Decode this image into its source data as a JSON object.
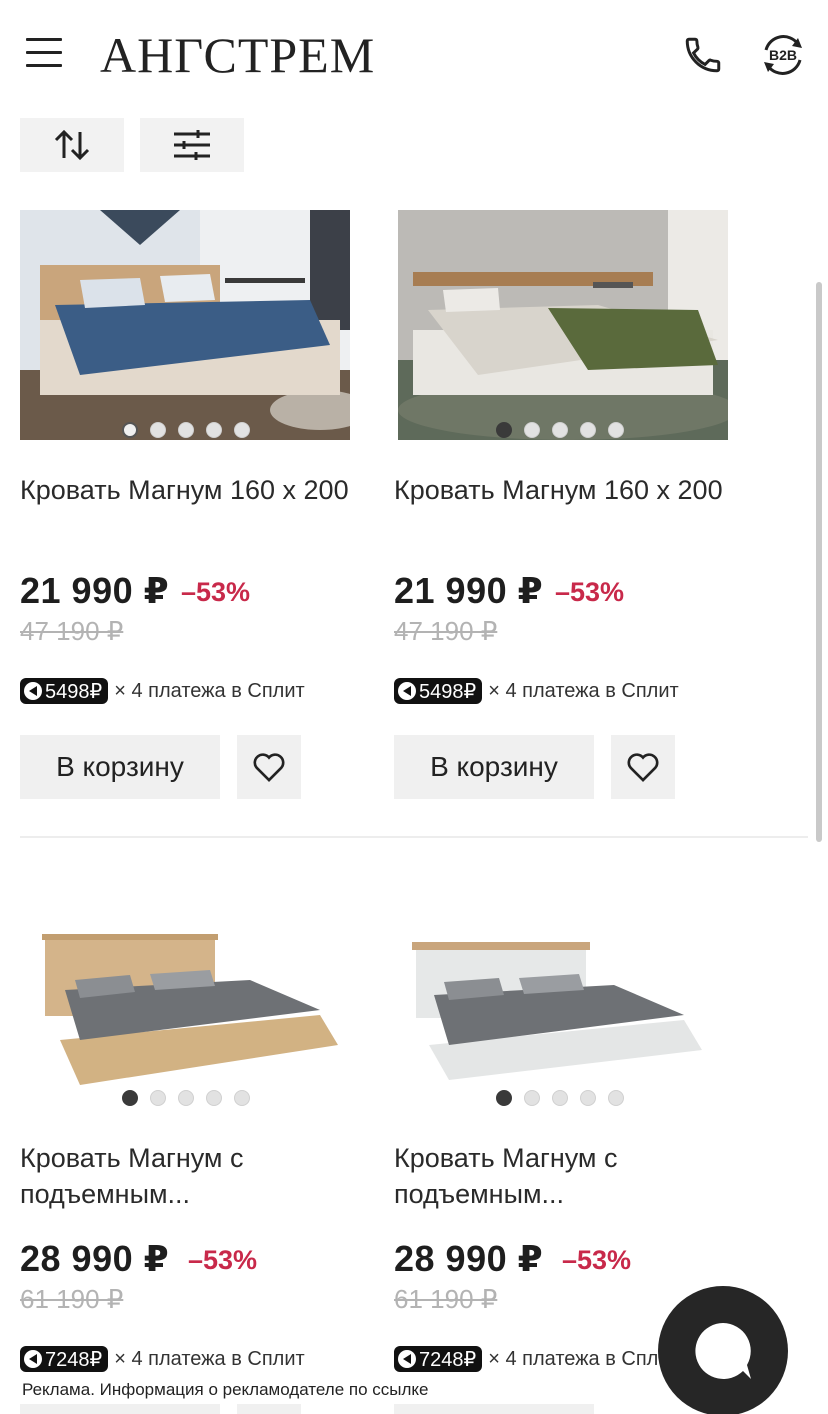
{
  "header": {
    "logo": "АНГСТРЕМ",
    "menu_icon": "hamburger-menu-icon",
    "phone_icon": "phone-icon",
    "b2b_label": "B2B"
  },
  "toolbar": {
    "sort_icon": "sort-arrows-icon",
    "filter_icon": "filter-sliders-icon"
  },
  "products": [
    {
      "title": "Кровать Магнум 160 х 200",
      "price": "21 990 ₽",
      "discount": "–53%",
      "old_price": "47 190 ₽",
      "split_amount": "5498₽",
      "split_text": "× 4 платежа в Сплит",
      "cart_label": "В корзину",
      "image_icon": "bed-photo-blue-bedding"
    },
    {
      "title": "Кровать Магнум 160 х 200",
      "price": "21 990 ₽",
      "discount": "–53%",
      "old_price": "47 190 ₽",
      "split_amount": "5498₽",
      "split_text": "× 4 платежа в Сплит",
      "cart_label": "В корзину",
      "image_icon": "bed-photo-green-bedding"
    },
    {
      "title": "Кровать Магнум с подъемным...",
      "price": "28 990 ₽",
      "discount": "–53%",
      "old_price": "61 190 ₽",
      "split_amount": "7248₽",
      "split_text": "× 4 платежа в Сплит",
      "image_icon": "bed-photo-oak"
    },
    {
      "title": "Кровать Магнум с подъемным...",
      "price": "28 990 ₽",
      "discount": "–53%",
      "old_price": "61 190 ₽",
      "split_amount": "7248₽",
      "split_text": "× 4 платежа в Спл",
      "image_icon": "bed-photo-white"
    }
  ],
  "chat": {
    "icon": "chat-bubble-icon"
  },
  "ad_note": "Реклама. Информация о рекламодателе по ссылке",
  "colors": {
    "discount": "#c8294a",
    "badge": "#111111",
    "button_bg": "#f0f0f0"
  }
}
